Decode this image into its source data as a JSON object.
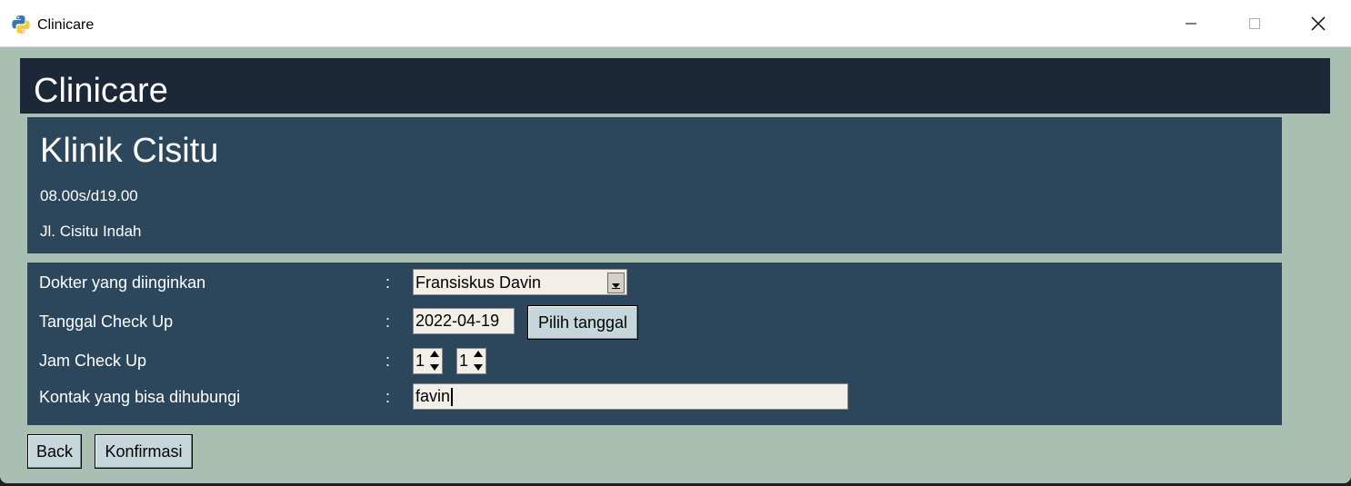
{
  "window": {
    "title": "Clinicare",
    "icon": "python-icon"
  },
  "header": {
    "title": "Clinicare"
  },
  "clinic": {
    "name": "Klinik Cisitu",
    "hours": "08.00s/d19.00",
    "address": "Jl. Cisitu Indah"
  },
  "form": {
    "separator": ":",
    "doctor": {
      "label": "Dokter yang diinginkan",
      "value": "Fransiskus Davin"
    },
    "date": {
      "label": "Tanggal Check Up",
      "value": "2022-04-19",
      "button": "Pilih tanggal"
    },
    "time": {
      "label": "Jam Check Up",
      "hour": "1",
      "minute": "1"
    },
    "contact": {
      "label": "Kontak yang bisa dihubungi",
      "value": "favin"
    }
  },
  "actions": {
    "back": "Back",
    "confirm": "Konfirmasi"
  },
  "colors": {
    "background": "#a8bfb2",
    "header": "#1c2838",
    "panel": "#2c475c",
    "button": "#c6d7dc"
  }
}
